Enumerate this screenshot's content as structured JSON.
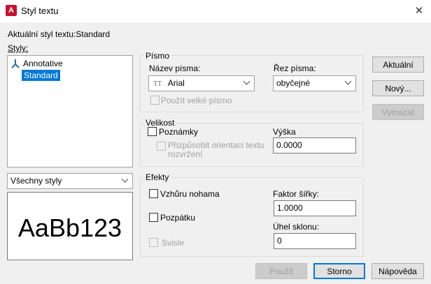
{
  "window": {
    "title": "Styl textu",
    "app_icon_letter": "A"
  },
  "current_style": {
    "text": "Aktuální styl textu:Standard"
  },
  "styles": {
    "label": "Styly:",
    "items": [
      {
        "label": "Annotative",
        "icon": "annotative-icon",
        "selected": false
      },
      {
        "label": "Standard",
        "selected": true
      }
    ],
    "filter": {
      "value": "Všechny styly"
    },
    "preview_text": "AaBb123"
  },
  "font": {
    "group_label": "Písmo",
    "font_name_label": "Název písma:",
    "font_name_value": "Arial",
    "font_icon_glyph": "TT",
    "font_style_label": "Řez písma:",
    "font_style_value": "obyčejné",
    "big_font_label": "Použít velké písmo"
  },
  "size": {
    "group_label": "Velikost",
    "annotative_label": "Poznámky",
    "match_orientation_label_1": "Přizpůsobit orientaci textu",
    "match_orientation_label_2": "rozvržení",
    "height_label": "Výška",
    "height_value": "0.0000"
  },
  "effects": {
    "group_label": "Efekty",
    "upside_down_label": "Vzhůru nohama",
    "backwards_label": "Pozpátku",
    "vertical_label": "Svisle",
    "width_factor_label": "Faktor šířky:",
    "width_factor_value": "1.0000",
    "oblique_label": "Úhel sklonu:",
    "oblique_value": "0"
  },
  "buttons": {
    "set_current": "Aktuální",
    "new": "Nový...",
    "delete": "Vymazat",
    "apply": "Použít",
    "cancel": "Storno",
    "help": "Nápověda"
  }
}
